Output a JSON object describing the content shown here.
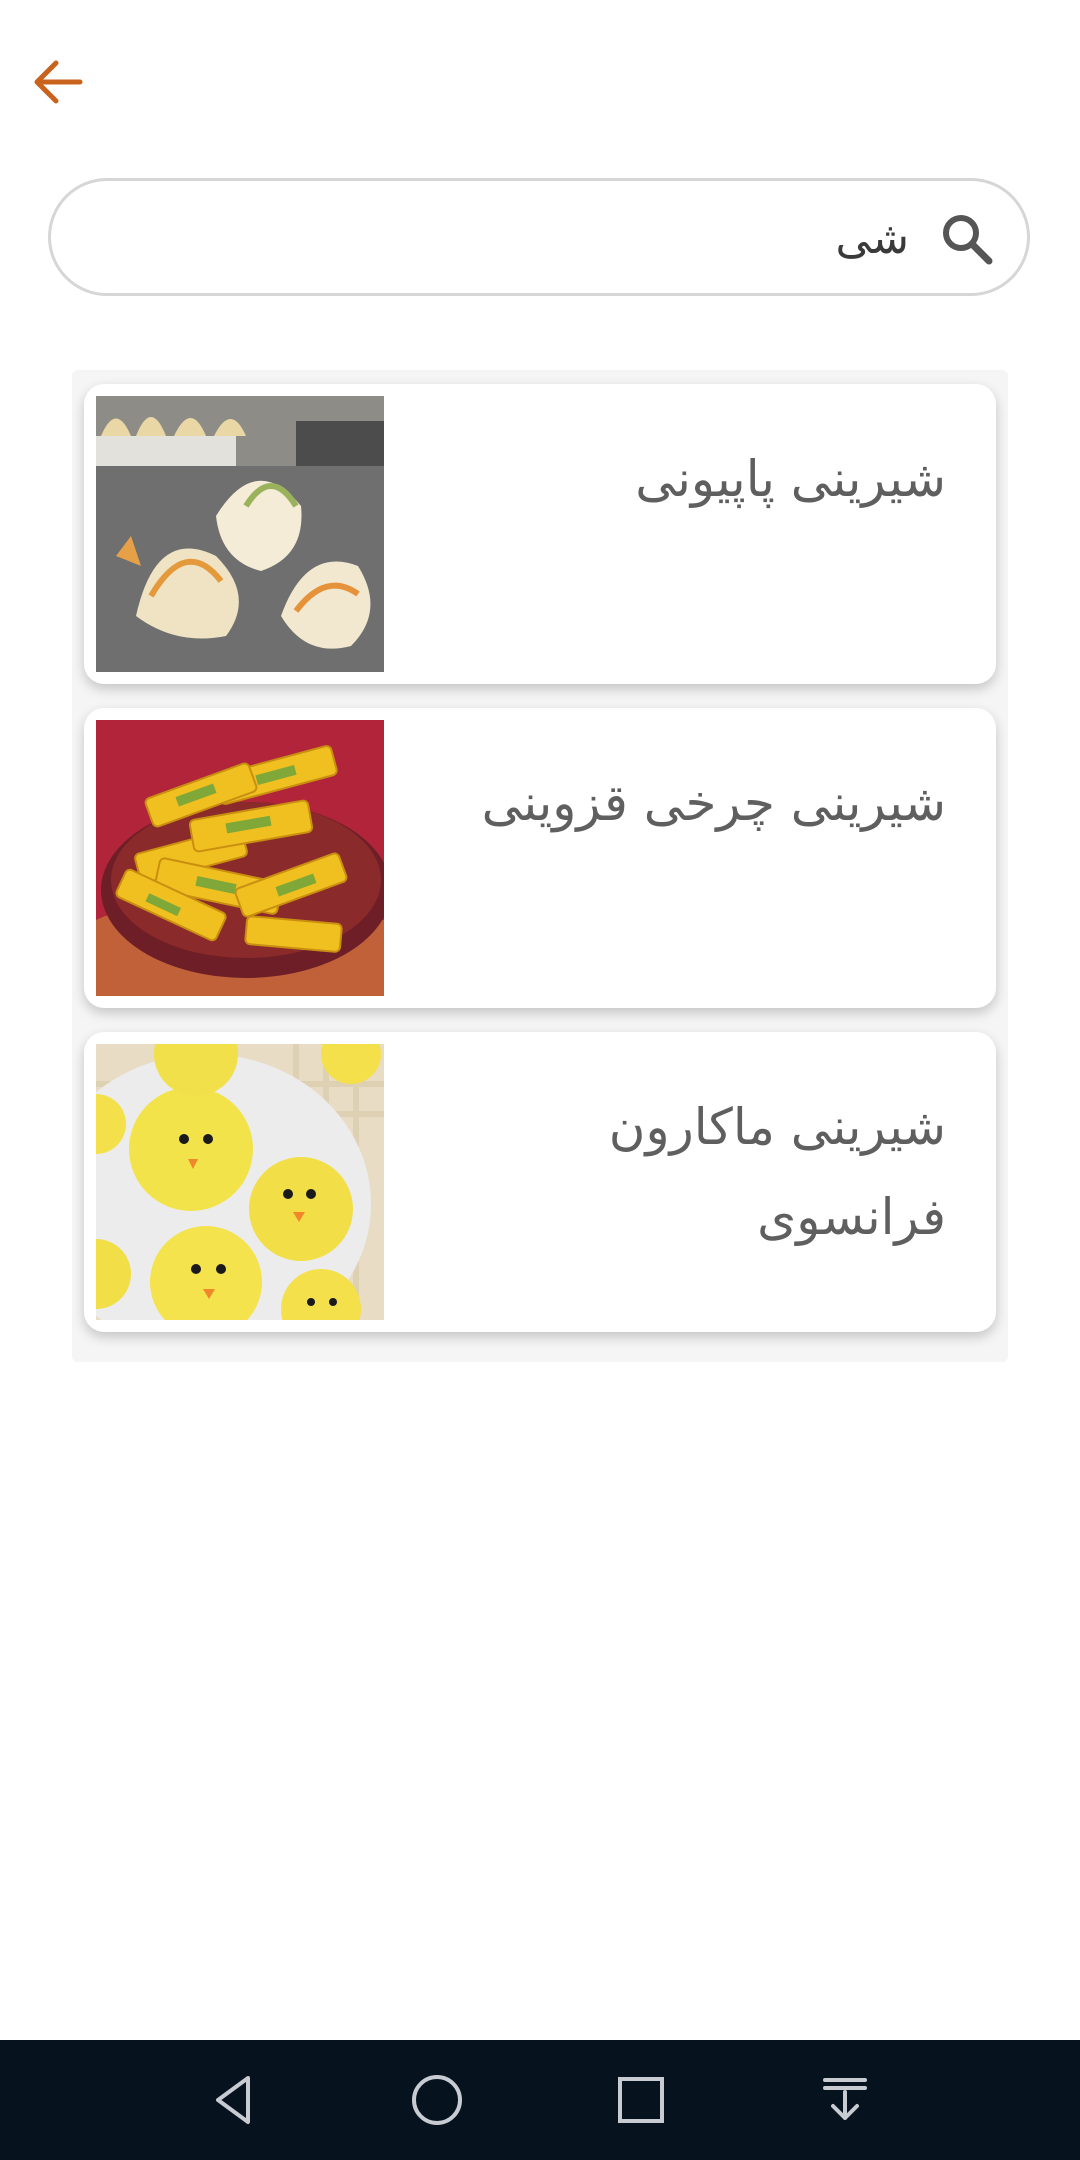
{
  "header": {
    "back_icon": "arrow-left-icon",
    "accent_color": "#c8621d"
  },
  "search": {
    "value": "شی",
    "icon": "search-icon"
  },
  "results": [
    {
      "title": "شیرینی پاپیونی",
      "image": "bowtie-pastry-photo"
    },
    {
      "title": "شیرینی چرخی قزوینی",
      "image": "qazvini-cookies-photo"
    },
    {
      "title": "شیرینی ماکارون فرانسوی",
      "image": "french-macaron-photo"
    }
  ],
  "navbar": {
    "buttons": [
      "back-icon",
      "home-icon",
      "recents-icon",
      "notifications-icon"
    ]
  }
}
